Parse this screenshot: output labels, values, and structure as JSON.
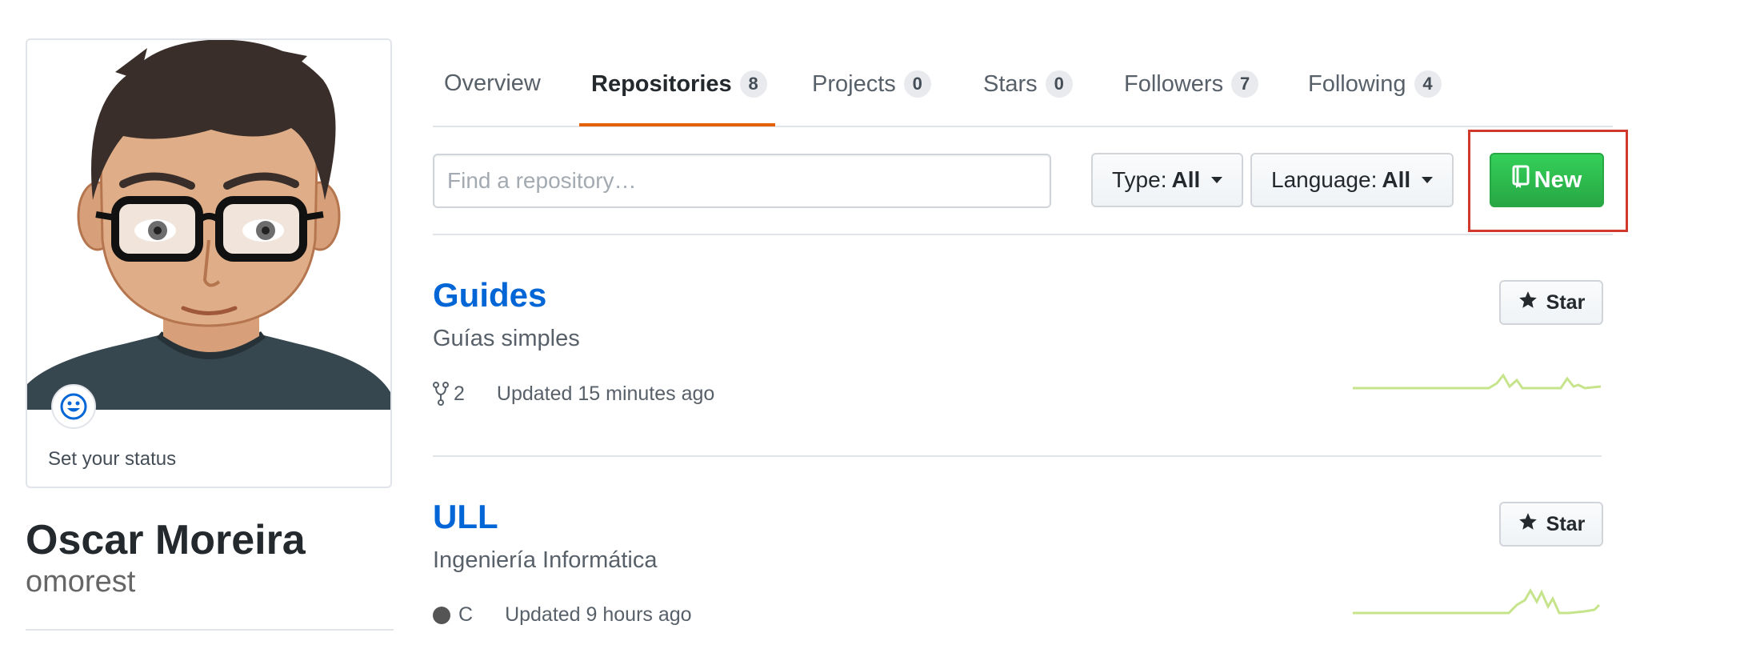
{
  "profile": {
    "status_label": "Set your status",
    "name": "Oscar Moreira",
    "login": "omorest"
  },
  "tabs": [
    {
      "label": "Overview",
      "count": null,
      "selected": false
    },
    {
      "label": "Repositories",
      "count": "8",
      "selected": true
    },
    {
      "label": "Projects",
      "count": "0",
      "selected": false
    },
    {
      "label": "Stars",
      "count": "0",
      "selected": false
    },
    {
      "label": "Followers",
      "count": "7",
      "selected": false
    },
    {
      "label": "Following",
      "count": "4",
      "selected": false
    }
  ],
  "filters": {
    "search_placeholder": "Find a repository…",
    "type_label": "Type:",
    "type_value": "All",
    "language_label": "Language:",
    "language_value": "All",
    "new_label": "New"
  },
  "repos": [
    {
      "name": "Guides",
      "description": "Guías simples",
      "forks": "2",
      "language": null,
      "updated": "Updated 15 minutes ago",
      "star_label": "Star"
    },
    {
      "name": "ULL",
      "description": "Ingeniería Informática",
      "forks": null,
      "language": "C",
      "updated": "Updated 9 hours ago",
      "star_label": "Star"
    }
  ],
  "colors": {
    "accent_tab": "#e36209",
    "link": "#0366d6",
    "new_button": "#28a745",
    "highlight": "#d0392b",
    "sparkline": "#c6e48b",
    "lang_c": "#555555"
  }
}
